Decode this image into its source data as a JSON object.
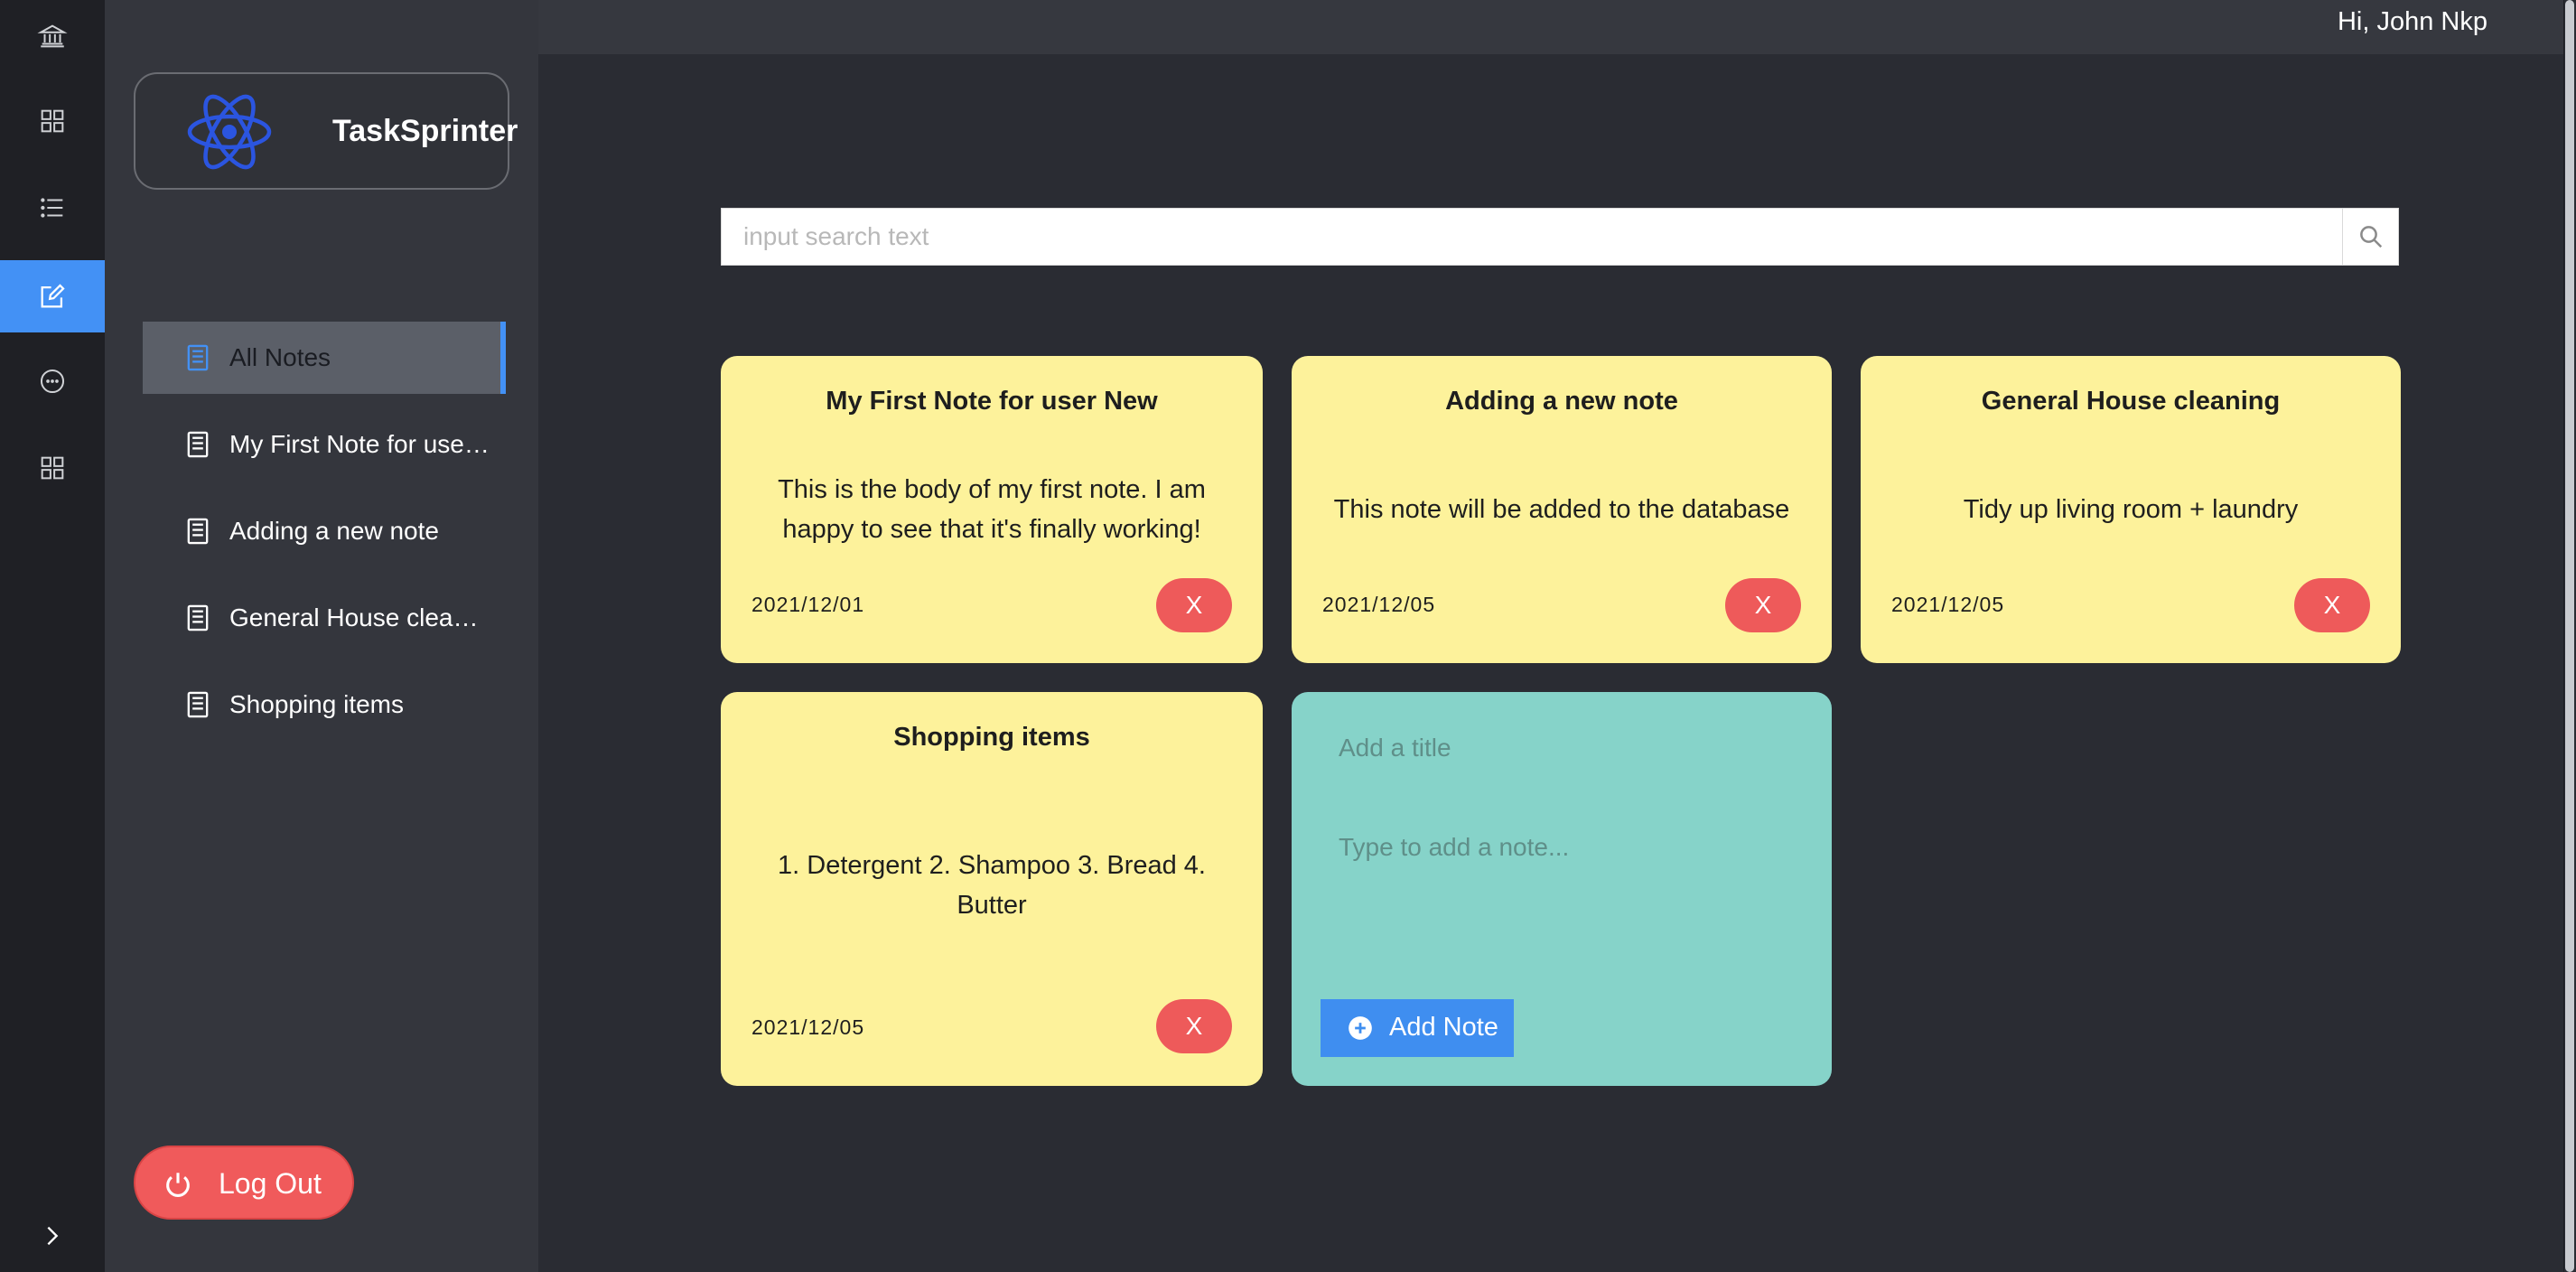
{
  "app": {
    "name": "TaskSprinter"
  },
  "header": {
    "greeting": "Hi, John Nkp"
  },
  "rail": {
    "items": [
      {
        "icon": "bank-icon",
        "active": false
      },
      {
        "icon": "grid-icon",
        "active": false
      },
      {
        "icon": "list-icon",
        "active": false
      },
      {
        "icon": "edit-icon",
        "active": true
      },
      {
        "icon": "chat-icon",
        "active": false
      },
      {
        "icon": "apps-icon",
        "active": false
      }
    ],
    "collapse_icon": "chevron-right-icon"
  },
  "sidebar": {
    "items": [
      {
        "label": "All Notes",
        "active": true
      },
      {
        "label": "My First Note for user New",
        "active": false
      },
      {
        "label": "Adding a new note",
        "active": false
      },
      {
        "label": "General House cleaning",
        "active": false
      },
      {
        "label": "Shopping items",
        "active": false
      }
    ],
    "logout_label": "Log Out"
  },
  "search": {
    "placeholder": "input search text"
  },
  "notes": [
    {
      "title": "My First Note for user New",
      "body": "This is the body of my first note. I am happy to see that it's finally working!",
      "date": "2021/12/01",
      "delete_label": "X"
    },
    {
      "title": "Adding a new note",
      "body": "This note will be added to the database",
      "date": "2021/12/05",
      "delete_label": "X"
    },
    {
      "title": "General House cleaning",
      "body": "Tidy up living room + laundry",
      "date": "2021/12/05",
      "delete_label": "X"
    },
    {
      "title": "Shopping items",
      "body": "1. Detergent 2. Shampoo 3. Bread 4. Butter",
      "date": "2021/12/05",
      "delete_label": "X"
    }
  ],
  "new_note": {
    "title_placeholder": "Add a title",
    "body_placeholder": "Type to add a note...",
    "add_label": "Add Note"
  },
  "colors": {
    "accent": "#4391f5",
    "note_bg": "#fdf29b",
    "new_note_bg": "#86d3c9",
    "danger": "#ee5a5a"
  }
}
